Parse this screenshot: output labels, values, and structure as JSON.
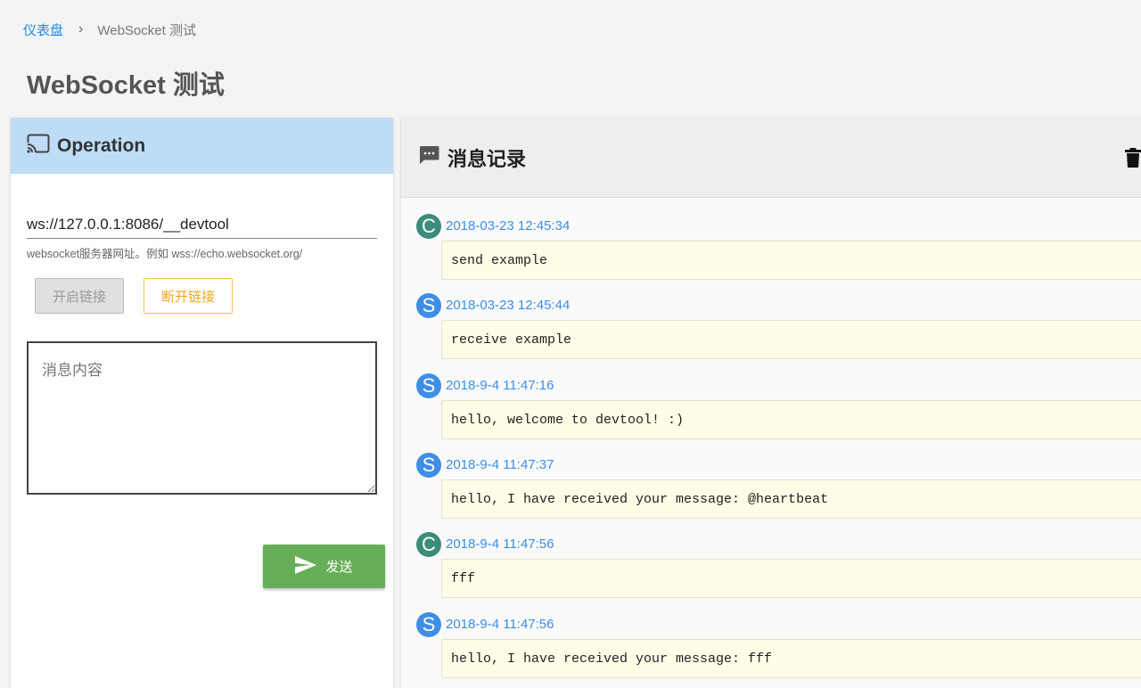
{
  "breadcrumb": {
    "home": "仪表盘",
    "separator": "›",
    "current": "WebSocket 测试"
  },
  "page_title": "WebSocket 测试",
  "operation": {
    "title": "Operation",
    "icon": "cast-icon",
    "ws_url": "ws://127.0.0.1:8086/__devtool",
    "ws_hint": "websocket服务器网址。例如 wss://echo.websocket.org/",
    "open_label": "开启链接",
    "close_label": "断开链接",
    "message_placeholder": "消息内容",
    "send_label": "发送"
  },
  "log": {
    "title": "消息记录",
    "entries": [
      {
        "who": "C",
        "time": "2018-03-23 12:45:34",
        "text": "send example"
      },
      {
        "who": "S",
        "time": "2018-03-23 12:45:44",
        "text": "receive example"
      },
      {
        "who": "S",
        "time": "2018-9-4 11:47:16",
        "text": "hello, welcome to devtool! :)"
      },
      {
        "who": "S",
        "time": "2018-9-4 11:47:37",
        "text": "hello, I have received your message: @heartbeat"
      },
      {
        "who": "C",
        "time": "2018-9-4 11:47:56",
        "text": "fff"
      },
      {
        "who": "S",
        "time": "2018-9-4 11:47:56",
        "text": "hello, I have received your message: fff"
      }
    ]
  },
  "colors": {
    "accent": "#1e88e5",
    "client": "#3c8c7a",
    "server": "#3e8ee8",
    "send": "#66ae58",
    "warning": "#f0a818"
  }
}
